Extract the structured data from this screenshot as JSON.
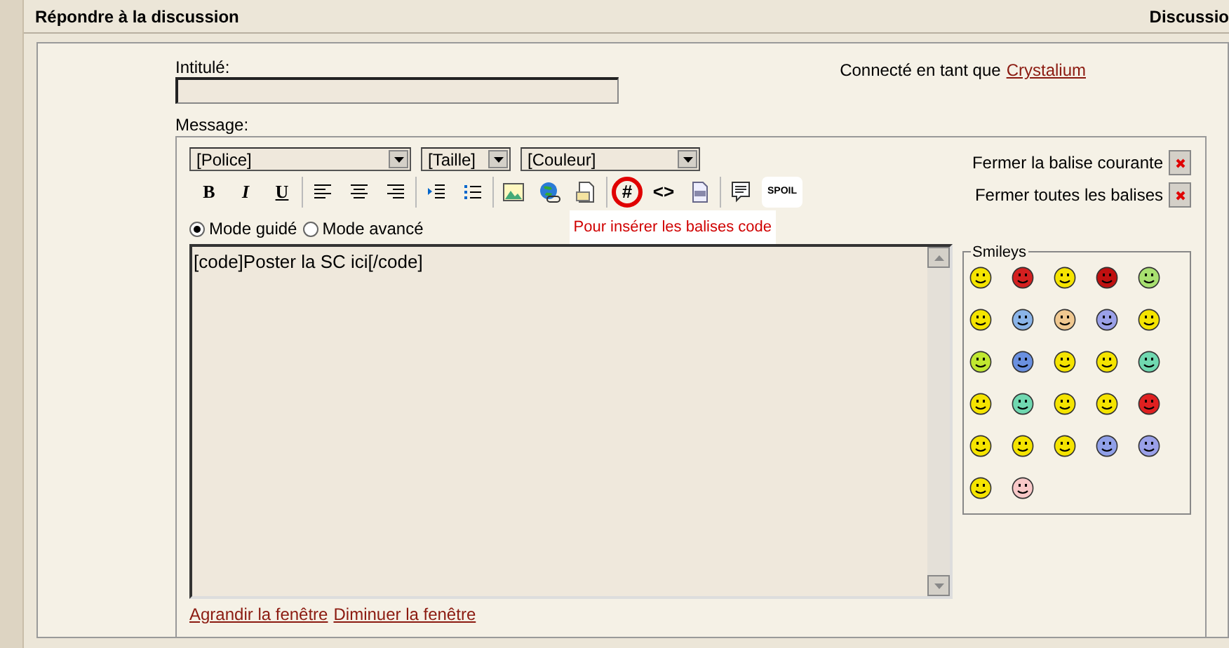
{
  "header": {
    "title": "Répondre à la discussion",
    "right_title": "Discussio"
  },
  "subject": {
    "label": "Intitulé:"
  },
  "logged_in": {
    "text": "Connecté en tant que",
    "user": "Crystalium"
  },
  "message": {
    "label": "Message:"
  },
  "selects": [
    {
      "value": "[Police]"
    },
    {
      "value": "[Taille]"
    },
    {
      "value": "[Couleur]"
    }
  ],
  "close_buttons": [
    {
      "label": "Fermer la balise courante"
    },
    {
      "label": "Fermer toutes les balises"
    }
  ],
  "toolbar": [
    [
      {
        "kind": "text",
        "label": "B",
        "highlighted": false
      },
      {
        "kind": "text",
        "label": "I",
        "highlighted": false
      },
      {
        "kind": "text",
        "label": "U",
        "highlighted": false
      }
    ],
    [
      {
        "kind": "icon",
        "highlighted": false
      },
      {
        "kind": "icon",
        "highlighted": false
      },
      {
        "kind": "icon",
        "highlighted": false
      }
    ],
    [
      {
        "kind": "icon",
        "highlighted": false
      },
      {
        "kind": "icon",
        "highlighted": false
      }
    ],
    [
      {
        "kind": "icon",
        "highlighted": false
      },
      {
        "kind": "icon",
        "highlighted": false
      },
      {
        "kind": "icon",
        "highlighted": false
      }
    ],
    [
      {
        "kind": "text",
        "label": "#",
        "highlighted": true
      },
      {
        "kind": "text",
        "label": "<>",
        "highlighted": false
      },
      {
        "kind": "icon",
        "highlighted": false
      }
    ],
    [
      {
        "kind": "icon",
        "highlighted": false
      },
      {
        "kind": "text",
        "label": "SPOIL",
        "highlighted": false
      }
    ]
  ],
  "modes": [
    {
      "label": "Mode guidé",
      "selected": true
    },
    {
      "label": "Mode avancé",
      "selected": false
    }
  ],
  "tooltip": "Pour insérer les balises code",
  "editor": {
    "value": "[code]Poster la SC ici[/code]"
  },
  "smileys": {
    "title": "Smileys"
  },
  "links": [
    "Agrandir la fenêtre",
    "Diminuer la fenêtre"
  ]
}
